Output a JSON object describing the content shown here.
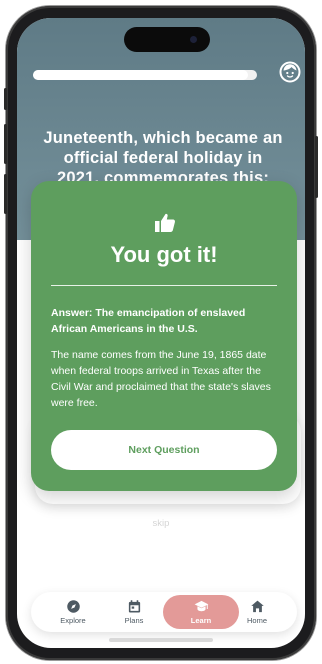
{
  "quiz": {
    "progress": 0.96,
    "question": "Juneteenth, which became an official federal holiday in 2021, commemorates this:"
  },
  "result": {
    "title": "You got it!",
    "answer": "Answer: The emancipation of enslaved African Americans in the U.S.",
    "explanation": "The name comes from the June 19, 1865 date when federal troops arrived in Texas after the Civil War and proclaimed that the state's slaves were free.",
    "next_label": "Next Question"
  },
  "skip_label": "skip",
  "nav": {
    "items": [
      {
        "label": "Explore",
        "icon": "compass-icon"
      },
      {
        "label": "Plans",
        "icon": "calendar-icon"
      },
      {
        "label": "Learn",
        "icon": "graduation-cap-icon",
        "active": true
      },
      {
        "label": "Home",
        "icon": "home-icon"
      }
    ]
  },
  "colors": {
    "header": "#6b8791",
    "card": "#5e9e5e",
    "nav_active": "#e39a98"
  }
}
